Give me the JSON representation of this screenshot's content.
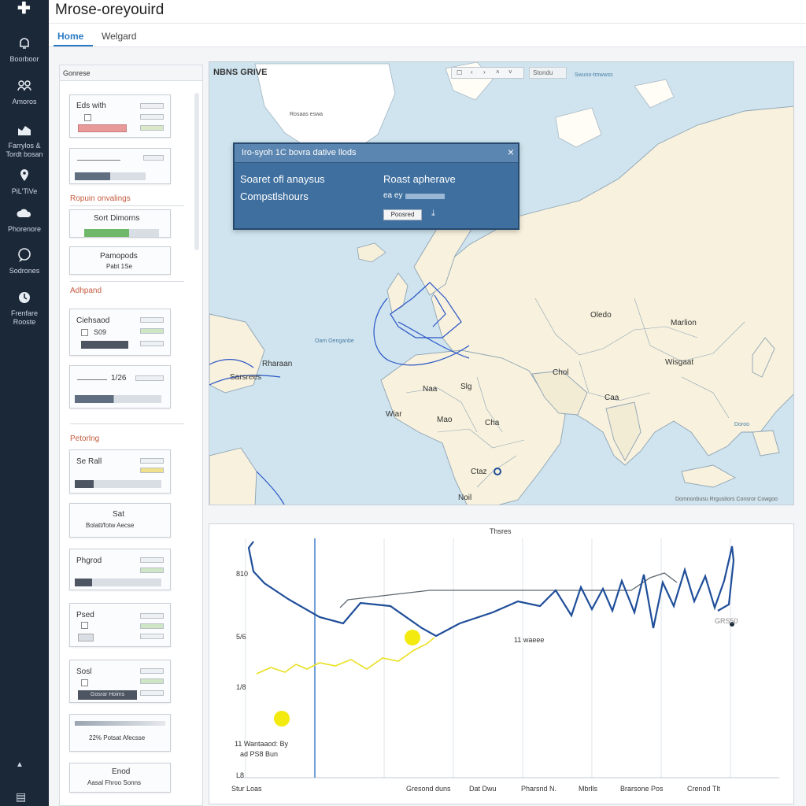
{
  "app": {
    "title": "Mrose-oreyouird"
  },
  "nav": {
    "home": "Home",
    "second": "Welgard"
  },
  "rail": {
    "items": [
      {
        "label": "Boorboor"
      },
      {
        "label": "Amoros"
      },
      {
        "label": "Farrylos & Tordt bosan"
      },
      {
        "label": "PiL'TiVe"
      },
      {
        "label": "Phorenore"
      },
      {
        "label": "Sodrones"
      },
      {
        "label": "Frenfare Rooste"
      }
    ]
  },
  "panel": {
    "title": "Gonrese",
    "cards": [
      {
        "title": "Eds with"
      },
      {
        "title": ""
      },
      {
        "title": "Sort Dimorns"
      },
      {
        "title": "Pamopods",
        "sub": "Pabt 1Se"
      },
      {
        "title": "Ciehsaod",
        "sub": "S09"
      },
      {
        "title": "1/26"
      },
      {
        "title": "Se Rall"
      },
      {
        "title": "Sat",
        "sub": "Bolatt/fotw Aecse"
      },
      {
        "title": "Phgrod"
      },
      {
        "title": "Psed"
      },
      {
        "title": "Sosl",
        "bar": "Gosrar Hoims"
      },
      {
        "title": "22% Potsat Afecsse"
      },
      {
        "title": "Enod",
        "sub": "Aasal Fhroo Sonns"
      }
    ],
    "sections": [
      "Ropuin onvalings",
      "Adhpand",
      "Petorlng"
    ]
  },
  "map": {
    "title": "NBNS GRIVE",
    "search": "Stondu",
    "top_small": "Swuno-tmwwss",
    "labels": [
      "Oledo",
      "Marlion",
      "Wisgaat",
      "Chol",
      "Wiar",
      "Naa",
      "Slg",
      "Mao",
      "Cha",
      "Ctaz",
      "Caa",
      "Noil",
      "Rharaan",
      "Sarsrees",
      "Doroo"
    ],
    "attribution": "Domnonbusu Rrgusitors Consror Cowgoo",
    "ocean": "Oam Oenganbe",
    "greenland": "Rosaas eswa",
    "popup": {
      "title": "Iro-syoh 1C bovra dative llods",
      "left1": "Soaret ofl anaysus",
      "left2": "Compstlshours",
      "right1": "Roast apherave",
      "right2": "ea ey",
      "button": "Poosred"
    }
  },
  "chart": {
    "title": "Thsres",
    "left_labels": [
      "810",
      "5/6",
      "1/8"
    ],
    "legend_text": "11 Wantaaod: By",
    "legend_sub": "ad PS8 Bun",
    "axis_left": "L8",
    "mid_label": "11 waeee",
    "right_label": "GRS50",
    "x_labels": [
      "Stur Loas",
      "Gresond duns",
      "Dat Dwu",
      "Pharsnd N.",
      "Mbrlls",
      "Brarsone Pos",
      "Crenod Tlt"
    ]
  },
  "colors": {
    "rail": "#1b2838",
    "accent": "#2b79c2",
    "popup": "#3e6f9f",
    "line_blue": "#1f4e99",
    "line_yellow": "#e8e020"
  }
}
